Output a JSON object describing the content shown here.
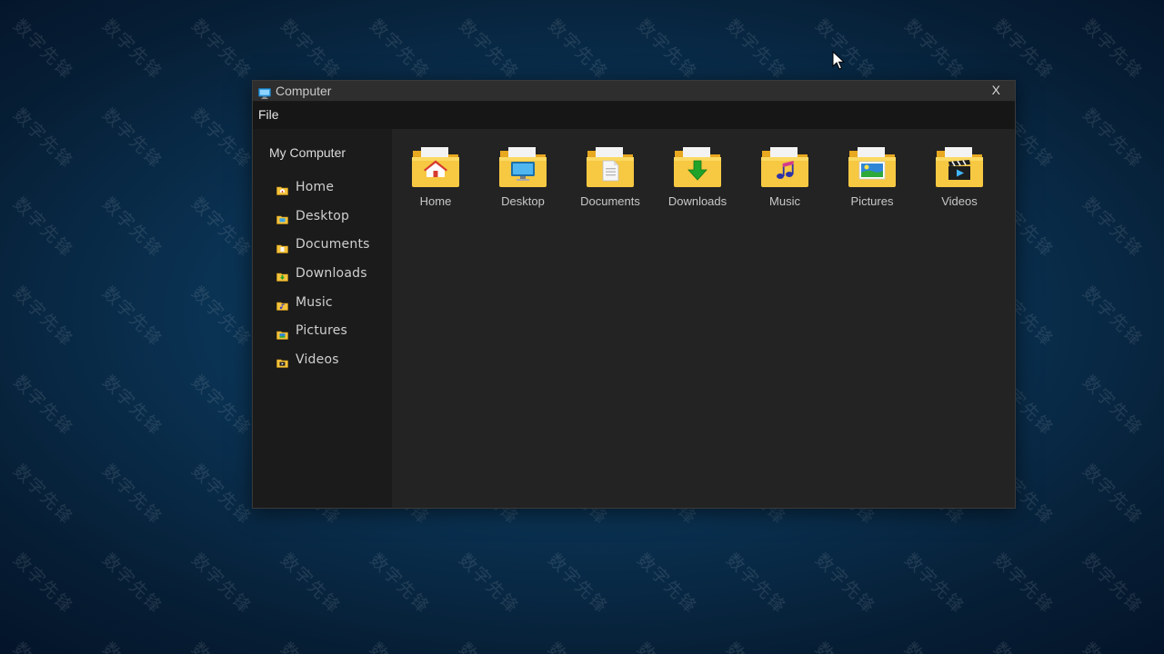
{
  "desktop": {
    "watermark_text": "数字先锋",
    "background_color": "#0a3151"
  },
  "window": {
    "title": "Computer",
    "close_label": "X",
    "title_icon": "computer-icon"
  },
  "menu": {
    "file_label": "File"
  },
  "sidebar": {
    "heading": "My Computer",
    "items": [
      {
        "label": "Home",
        "icon": "home-icon"
      },
      {
        "label": "Desktop",
        "icon": "desktop-icon"
      },
      {
        "label": "Documents",
        "icon": "documents-icon"
      },
      {
        "label": "Downloads",
        "icon": "downloads-icon"
      },
      {
        "label": "Music",
        "icon": "music-icon"
      },
      {
        "label": "Pictures",
        "icon": "pictures-icon"
      },
      {
        "label": "Videos",
        "icon": "videos-icon"
      }
    ]
  },
  "content": {
    "folders": [
      {
        "label": "Home",
        "icon": "home-folder-icon"
      },
      {
        "label": "Desktop",
        "icon": "desktop-folder-icon"
      },
      {
        "label": "Documents",
        "icon": "documents-folder-icon"
      },
      {
        "label": "Downloads",
        "icon": "downloads-folder-icon"
      },
      {
        "label": "Music",
        "icon": "music-folder-icon"
      },
      {
        "label": "Pictures",
        "icon": "pictures-folder-icon"
      },
      {
        "label": "Videos",
        "icon": "videos-folder-icon"
      }
    ]
  },
  "colors": {
    "folder_yellow": "#f5c23c",
    "folder_light": "#fbd962",
    "window_bg": "#232323",
    "sidebar_bg": "#1b1b1b",
    "menubar_bg": "#161616",
    "titlebar_bg": "#2e2e2e",
    "text": "#c8c8c8"
  }
}
